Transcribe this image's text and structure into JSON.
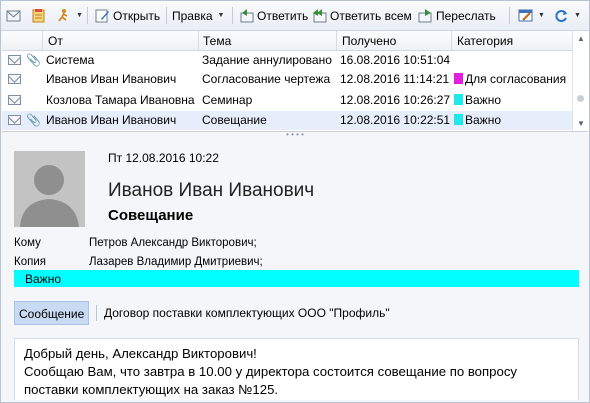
{
  "toolbar": {
    "open_label": "Открыть",
    "edit_label": "Правка",
    "reply_label": "Ответить",
    "reply_all_label": "Ответить всем",
    "forward_label": "Переслать"
  },
  "list": {
    "columns": [
      "От",
      "Тема",
      "Получено",
      "Категория"
    ],
    "rows": [
      {
        "from": "Система",
        "subject": "Задание аннулировано",
        "received": "16.08.2016 10:51:04",
        "category": "",
        "category_color": "",
        "attachment": true,
        "selected": false
      },
      {
        "from": "Иванов Иван Иванович",
        "subject": "Согласование чертежа",
        "received": "12.08.2016 11:14:21",
        "category": "Для согласования",
        "category_color": "#e21fe0",
        "attachment": false,
        "selected": false
      },
      {
        "from": "Козлова Тамара Ивановна",
        "subject": "Семинар",
        "received": "12.08.2016 10:26:27",
        "category": "Важно",
        "category_color": "#1ee8e8",
        "attachment": false,
        "selected": false
      },
      {
        "from": "Иванов Иван Иванович",
        "subject": "Совещание",
        "received": "12.08.2016 10:22:51",
        "category": "Важно",
        "category_color": "#1ee8e8",
        "attachment": true,
        "selected": true
      }
    ]
  },
  "preview": {
    "datetime": "Пт 12.08.2016 10:22",
    "sender": "Иванов Иван Иванович",
    "subject": "Совещание",
    "to_label": "Кому",
    "to_value": "Петров Александр Викторович;",
    "cc_label": "Копия",
    "cc_value": "Лазарев Владимир Дмитриевич;",
    "category": "Важно",
    "category_color": "#00ffff",
    "tab_message": "Сообщение",
    "tab_document": "Договор поставки комплектующих ООО \"Профиль\"",
    "body_lines": [
      "Добрый день, Александр Викторович!",
      "Сообщаю Вам, что завтра в 10.00 у директора состоится совещание по вопросу",
      "поставки комплектующих на заказ №125."
    ]
  }
}
